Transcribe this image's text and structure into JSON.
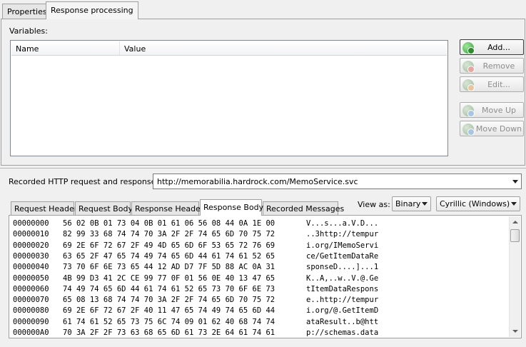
{
  "tabs": [
    {
      "label": "Properties",
      "active": false
    },
    {
      "label": "Response processing",
      "active": true
    }
  ],
  "variables": {
    "label": "Variables:",
    "columns": [
      "Name",
      "Value"
    ]
  },
  "buttons": {
    "add": "Add...",
    "remove": "Remove",
    "edit": "Edit...",
    "move_up": "Move Up",
    "move_down": "Move Down"
  },
  "recorded": {
    "label": "Recorded HTTP request and response:",
    "url": "http://memorabilia.hardrock.com/MemoService.svc"
  },
  "view_as": {
    "label": "View as:",
    "mode": "Binary",
    "encoding": "Cyrillic (Windows)"
  },
  "sub_tabs": [
    {
      "label": "Request Header",
      "active": false
    },
    {
      "label": "Request Body",
      "active": false
    },
    {
      "label": "Response Header",
      "active": false
    },
    {
      "label": "Response Body",
      "active": true
    },
    {
      "label": "Recorded Messages",
      "active": false
    }
  ],
  "hex_rows": [
    {
      "offset": "00000000",
      "bytes": "56 02 0B 01 73 04 0B 01 61 06 56 08 44 0A 1E 00",
      "ascii": "V...s...a.V.D..."
    },
    {
      "offset": "00000010",
      "bytes": "82 99 33 68 74 74 70 3A 2F 2F 74 65 6D 70 75 72",
      "ascii": "..3http://tempur"
    },
    {
      "offset": "00000020",
      "bytes": "69 2E 6F 72 67 2F 49 4D 65 6D 6F 53 65 72 76 69",
      "ascii": "i.org/IMemoServi"
    },
    {
      "offset": "00000030",
      "bytes": "63 65 2F 47 65 74 49 74 65 6D 44 61 74 61 52 65",
      "ascii": "ce/GetItemDataRe"
    },
    {
      "offset": "00000040",
      "bytes": "73 70 6F 6E 73 65 44 12 AD D7 7F 5D 88 AC 0A 31",
      "ascii": "sponseD....]...1"
    },
    {
      "offset": "00000050",
      "bytes": "4B 99 D3 41 2C CE 99 77 0F 01 56 0E 40 13 47 65",
      "ascii": "K..A,..w..V.@.Ge"
    },
    {
      "offset": "00000060",
      "bytes": "74 49 74 65 6D 44 61 74 61 52 65 73 70 6F 6E 73",
      "ascii": "tItemDataRespons"
    },
    {
      "offset": "00000070",
      "bytes": "65 08 13 68 74 74 70 3A 2F 2F 74 65 6D 70 75 72",
      "ascii": "e..http://tempur"
    },
    {
      "offset": "00000080",
      "bytes": "69 2E 6F 72 67 2F 40 11 47 65 74 49 74 65 6D 44",
      "ascii": "i.org/@.GetItemD"
    },
    {
      "offset": "00000090",
      "bytes": "61 74 61 52 65 73 75 6C 74 09 01 62 40 68 74 74",
      "ascii": "ataResult..b@htt"
    },
    {
      "offset": "000000A0",
      "bytes": "70 3A 2F 2F 73 63 68 65 6D 61 73 2E 64 61 74 61",
      "ascii": "p://schemas.data"
    }
  ]
}
